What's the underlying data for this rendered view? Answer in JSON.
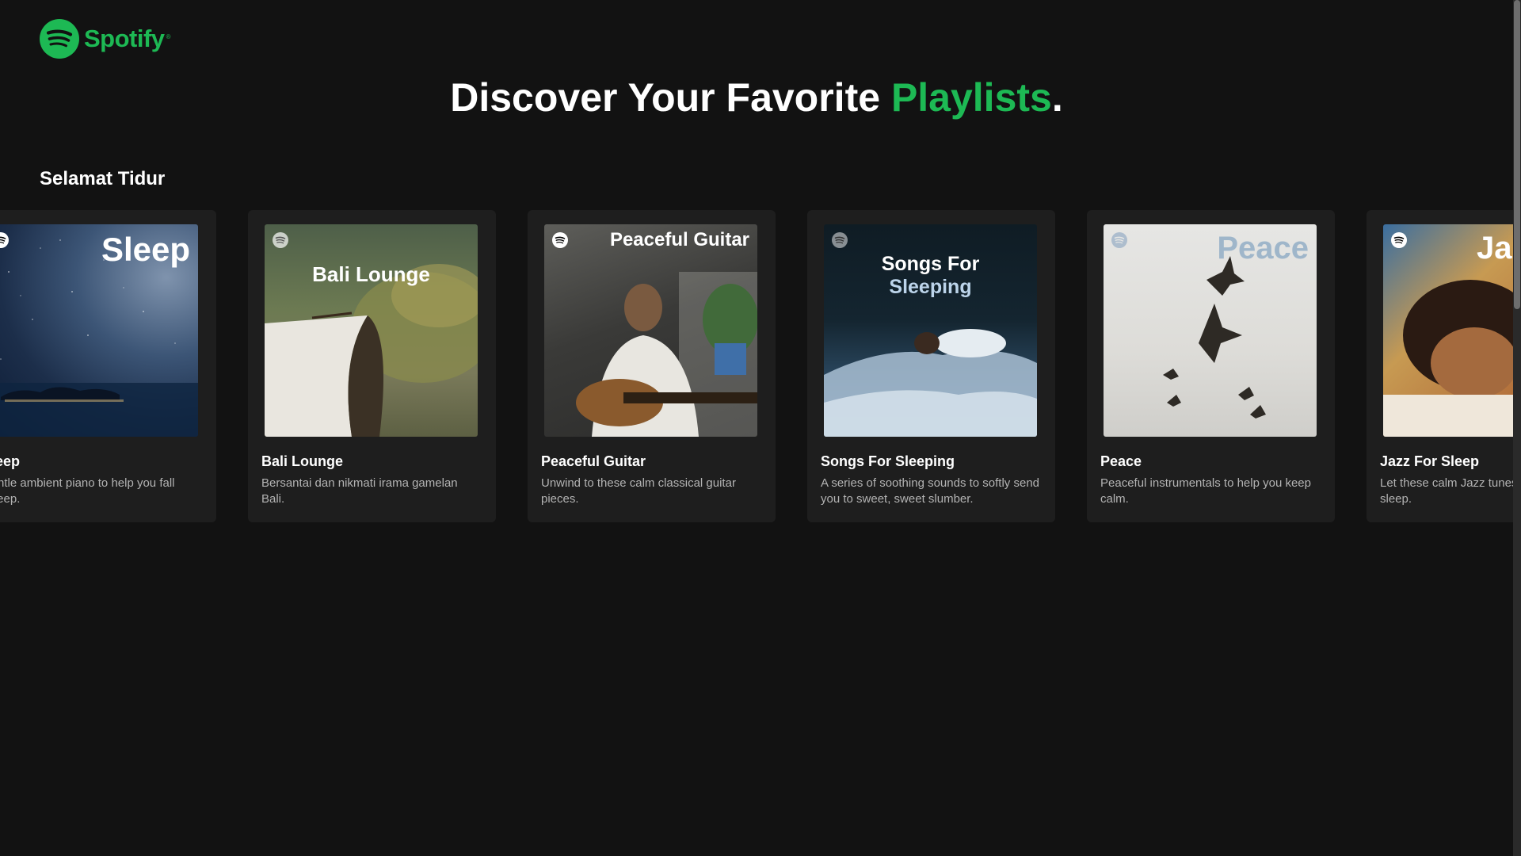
{
  "brand": {
    "name": "Spotify",
    "trademark": "®",
    "color": "#1db954"
  },
  "hero": {
    "title_prefix": "Discover Your Favorite ",
    "title_accent": "Playlists",
    "title_suffix": ".",
    "accent_color": "#1db954"
  },
  "section": {
    "title": "Selamat Tidur"
  },
  "playlists": [
    {
      "cover_text": "Sleep",
      "title": "Sleep",
      "description": "Gentle ambient piano to help you fall asleep."
    },
    {
      "cover_text": "Bali Lounge",
      "title": "Bali Lounge",
      "description": "Bersantai dan nikmati irama gamelan Bali."
    },
    {
      "cover_text": "Peaceful Guitar",
      "title": "Peaceful Guitar",
      "description": "Unwind to these calm classical guitar pieces."
    },
    {
      "cover_text_line1": "Songs For",
      "cover_text_line2": "Sleeping",
      "title": "Songs For Sleeping",
      "description": "A series of soothing sounds to softly send you to sweet, sweet slumber."
    },
    {
      "cover_text": "Peace",
      "title": "Peace",
      "description": "Peaceful instrumentals to help you keep calm."
    },
    {
      "cover_text": "Ja",
      "title": "Jazz For Sleep",
      "description": "Let these calm Jazz tunes lull you to sleep."
    }
  ]
}
